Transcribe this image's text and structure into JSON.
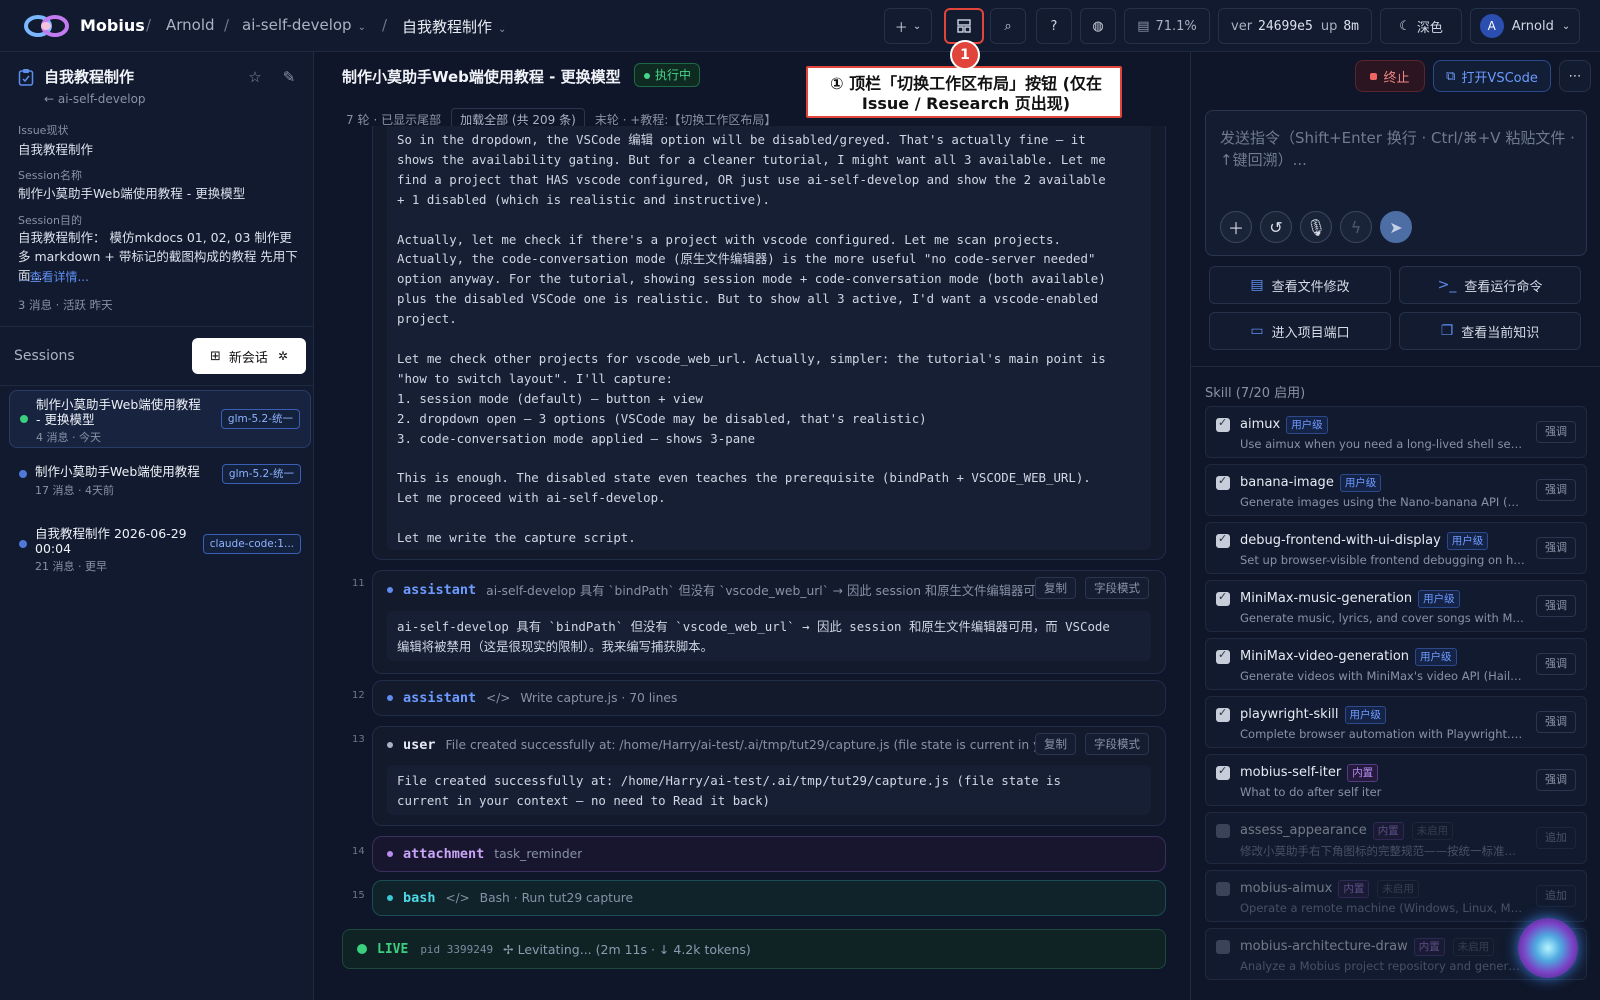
{
  "topbar": {
    "brand": "Mobius",
    "breadcrumbs": [
      "Arnold",
      "ai-self-develop",
      "自我教程制作"
    ],
    "usage": "71.1%",
    "ver_label": "ver",
    "ver_value": "24699e5",
    "up_label": "up",
    "up_value": "8m",
    "theme": "深色",
    "user_initial": "A",
    "user_name": "Arnold"
  },
  "annotation": {
    "number": "1",
    "text": "① 顶栏「切换工作区布局」按钮 (仅在 Issue / Research 页出现)"
  },
  "sidebar": {
    "title": "自我教程制作",
    "project": "← ai-self-develop",
    "issue_label": "Issue现状",
    "issue_value": "自我教程制作",
    "session_name_label": "Session名称",
    "session_name_value": "制作小莫助手Web端使用教程 - 更换模型",
    "goal_label": "Session目的",
    "goal_value": "自我教程制作： 模仿mkdocs 01, 02, 03 制作更多 markdown + 带标记的截图构成的教程 先用下面...",
    "more_link": "...查看详情...",
    "meta": "3 消息 · 活跃 昨天",
    "sessions_header": "Sessions",
    "new_session": "新会话",
    "sessions": [
      {
        "title": "制作小莫助手Web端使用教程 - 更换模型",
        "meta": "4 消息 · 今天",
        "badge": "glm-5.2-统一"
      },
      {
        "title": "制作小莫助手Web端使用教程",
        "meta": "17 消息 · 4天前",
        "badge": "glm-5.2-统一"
      },
      {
        "title": "自我教程制作 2026-06-29 00:04",
        "meta": "21 消息 · 更早",
        "badge": "claude-code:1..."
      }
    ]
  },
  "center": {
    "title": "制作小莫助手Web端使用教程 - 更换模型",
    "status": "执行中",
    "feed_rounds": "7 轮",
    "feed_tail": "· 已显示尾部",
    "load_all": "加载全部 (共 209 条)",
    "feed_last": "末轮 · +教程:【切换工作区布局】",
    "code_text": "So in the dropdown, the VSCode 编辑 option will be disabled/greyed. That's actually fine — it\nshows the availability gating. But for a cleaner tutorial, I might want all 3 available. Let me\nfind a project that HAS vscode configured, OR just use ai-self-develop and show the 2 available\n+ 1 disabled (which is realistic and instructive).\n\nActually, let me check if there's a project with vscode configured. Let me scan projects.\nActually, the code-conversation mode (原生文件编辑器) is the more useful \"no code-server needed\"\noption anyway. For the tutorial, showing session mode + code-conversation mode (both available)\nplus the disabled VSCode one is realistic. But to show all 3 active, I'd want a vscode-enabled\nproject.\n\nLet me check other projects for vscode_web_url. Actually, simpler: the tutorial's main point is\n\"how to switch layout\". I'll capture:\n1. session mode (default) — button + view\n2. dropdown open — 3 options (VSCode may be disabled, that's realistic)\n3. code-conversation mode applied — shows 3-pane\n\nThis is enough. The disabled state even teaches the prerequisite (bindPath + VSCODE_WEB_URL).\nLet me proceed with ai-self-develop.\n\nLet me write the capture script.",
    "copy_label": "复制",
    "field_label": "字段模式",
    "messages": [
      {
        "num": "11",
        "role": "assistant",
        "summary": "ai-self-develop 具有 `bindPath` 但没有 `vscode_web_url` → 因此 session 和原生文件编辑器可...",
        "body": "ai-self-develop 具有 `bindPath` 但没有 `vscode_web_url` → 因此 session 和原生文件编辑器可用，而 VSCode\n编辑将被禁用（这是很现实的限制）。我来编写捕获脚本。"
      },
      {
        "num": "12",
        "role": "assistant",
        "summary": "Write capture.js · 70 lines"
      },
      {
        "num": "13",
        "role": "user",
        "summary": "File created successfully at: /home/Harry/ai-test/.ai/tmp/tut29/capture.js (file state is current in you...",
        "body": "File created successfully at: /home/Harry/ai-test/.ai/tmp/tut29/capture.js (file state is\ncurrent in your context — no need to Read it back)"
      },
      {
        "num": "14",
        "role": "attachment",
        "summary": "task_reminder"
      },
      {
        "num": "15",
        "role": "bash",
        "summary": "Bash · Run tut29 capture"
      }
    ],
    "live_label": "LIVE",
    "live_pid": "pid 3399249",
    "live_text": "✢ Levitating... (2m 11s · ↓ 4.2k tokens)"
  },
  "right": {
    "stop": "终止",
    "open_vscode": "打开VSCode",
    "prompt_placeholder": "发送指令（Shift+Enter 换行 · Ctrl/⌘+V 粘贴文件 · ↑键回溯）...",
    "quick_actions": [
      "查看文件修改",
      "查看运行命令",
      "进入项目端口",
      "查看当前知识"
    ],
    "skill_header": "Skill (7/20 启用)",
    "skills": [
      {
        "name": "aimux",
        "level": "用户级",
        "desc": "Use aimux when you need a long-lived shell session...",
        "action": "强调",
        "enabled": true
      },
      {
        "name": "banana-image",
        "level": "用户级",
        "desc": "Generate images using the Nano-banana API (DALL...",
        "action": "强调",
        "enabled": true
      },
      {
        "name": "debug-frontend-with-ui-display",
        "level": "用户级",
        "desc": "Set up browser-visible frontend debugging on headl...",
        "action": "强调",
        "enabled": true
      },
      {
        "name": "MiniMax-music-generation",
        "level": "用户级",
        "desc": "Generate music, lyrics, and cover songs with MiniM...",
        "action": "强调",
        "enabled": true
      },
      {
        "name": "MiniMax-video-generation",
        "level": "用户级",
        "desc": "Generate videos with MiniMax's video API (Hailuo-2....",
        "action": "强调",
        "enabled": true
      },
      {
        "name": "playwright-skill",
        "level": "用户级",
        "desc": "Complete browser automation with Playwright. Auto...",
        "action": "强调",
        "enabled": true
      },
      {
        "name": "mobius-self-iter",
        "level": "内置",
        "desc": "What to do after self iter",
        "action": "强调",
        "enabled": true
      },
      {
        "name": "assess_appearance",
        "level": "内置",
        "disabled_tag": "未启用",
        "desc": "修改小莫助手右下角图标的完整规范——按统一标准重...",
        "action": "追加",
        "enabled": false
      },
      {
        "name": "mobius-aimux",
        "level": "内置",
        "disabled_tag": "未启用",
        "desc": "Operate a remote machine (Windows, Linux, Mac) t...",
        "action": "追加",
        "enabled": false
      },
      {
        "name": "mobius-architecture-draw",
        "level": "内置",
        "disabled_tag": "未启用",
        "desc": "Analyze a Mobius project repository and generate a...",
        "action": "追加",
        "enabled": false
      }
    ]
  }
}
